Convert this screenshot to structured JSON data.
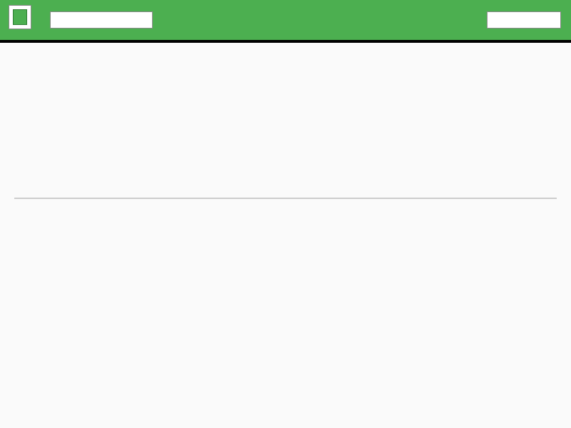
{
  "header": {
    "search_value": "",
    "action_label": ""
  },
  "title": {
    "subtitle": "",
    "heading": ""
  },
  "colors": {
    "accent": "#4caf50",
    "background": "#fafafa",
    "text": "#222222"
  },
  "list_top": [
    {
      "label": "",
      "value": ""
    },
    {
      "label": "",
      "value": ""
    },
    {
      "label": "",
      "value": ""
    },
    {
      "label": "",
      "value": ""
    }
  ],
  "list_bottom": [
    {
      "label": "",
      "value": ""
    },
    {
      "label": "",
      "value": ""
    },
    {
      "label": "",
      "value": ""
    }
  ]
}
